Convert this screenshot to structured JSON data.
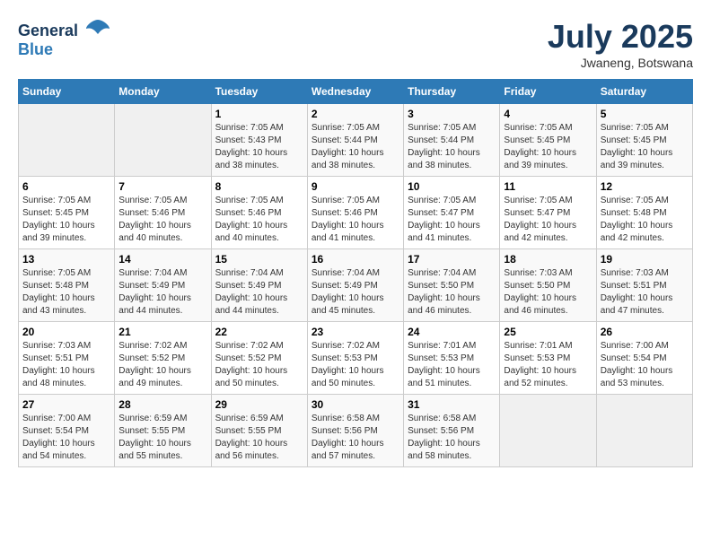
{
  "header": {
    "logo_general": "General",
    "logo_blue": "Blue",
    "month_title": "July 2025",
    "location": "Jwaneng, Botswana"
  },
  "calendar": {
    "days_of_week": [
      "Sunday",
      "Monday",
      "Tuesday",
      "Wednesday",
      "Thursday",
      "Friday",
      "Saturday"
    ],
    "weeks": [
      [
        {
          "day": "",
          "details": ""
        },
        {
          "day": "",
          "details": ""
        },
        {
          "day": "1",
          "details": "Sunrise: 7:05 AM\nSunset: 5:43 PM\nDaylight: 10 hours and 38 minutes."
        },
        {
          "day": "2",
          "details": "Sunrise: 7:05 AM\nSunset: 5:44 PM\nDaylight: 10 hours and 38 minutes."
        },
        {
          "day": "3",
          "details": "Sunrise: 7:05 AM\nSunset: 5:44 PM\nDaylight: 10 hours and 38 minutes."
        },
        {
          "day": "4",
          "details": "Sunrise: 7:05 AM\nSunset: 5:45 PM\nDaylight: 10 hours and 39 minutes."
        },
        {
          "day": "5",
          "details": "Sunrise: 7:05 AM\nSunset: 5:45 PM\nDaylight: 10 hours and 39 minutes."
        }
      ],
      [
        {
          "day": "6",
          "details": "Sunrise: 7:05 AM\nSunset: 5:45 PM\nDaylight: 10 hours and 39 minutes."
        },
        {
          "day": "7",
          "details": "Sunrise: 7:05 AM\nSunset: 5:46 PM\nDaylight: 10 hours and 40 minutes."
        },
        {
          "day": "8",
          "details": "Sunrise: 7:05 AM\nSunset: 5:46 PM\nDaylight: 10 hours and 40 minutes."
        },
        {
          "day": "9",
          "details": "Sunrise: 7:05 AM\nSunset: 5:46 PM\nDaylight: 10 hours and 41 minutes."
        },
        {
          "day": "10",
          "details": "Sunrise: 7:05 AM\nSunset: 5:47 PM\nDaylight: 10 hours and 41 minutes."
        },
        {
          "day": "11",
          "details": "Sunrise: 7:05 AM\nSunset: 5:47 PM\nDaylight: 10 hours and 42 minutes."
        },
        {
          "day": "12",
          "details": "Sunrise: 7:05 AM\nSunset: 5:48 PM\nDaylight: 10 hours and 42 minutes."
        }
      ],
      [
        {
          "day": "13",
          "details": "Sunrise: 7:05 AM\nSunset: 5:48 PM\nDaylight: 10 hours and 43 minutes."
        },
        {
          "day": "14",
          "details": "Sunrise: 7:04 AM\nSunset: 5:49 PM\nDaylight: 10 hours and 44 minutes."
        },
        {
          "day": "15",
          "details": "Sunrise: 7:04 AM\nSunset: 5:49 PM\nDaylight: 10 hours and 44 minutes."
        },
        {
          "day": "16",
          "details": "Sunrise: 7:04 AM\nSunset: 5:49 PM\nDaylight: 10 hours and 45 minutes."
        },
        {
          "day": "17",
          "details": "Sunrise: 7:04 AM\nSunset: 5:50 PM\nDaylight: 10 hours and 46 minutes."
        },
        {
          "day": "18",
          "details": "Sunrise: 7:03 AM\nSunset: 5:50 PM\nDaylight: 10 hours and 46 minutes."
        },
        {
          "day": "19",
          "details": "Sunrise: 7:03 AM\nSunset: 5:51 PM\nDaylight: 10 hours and 47 minutes."
        }
      ],
      [
        {
          "day": "20",
          "details": "Sunrise: 7:03 AM\nSunset: 5:51 PM\nDaylight: 10 hours and 48 minutes."
        },
        {
          "day": "21",
          "details": "Sunrise: 7:02 AM\nSunset: 5:52 PM\nDaylight: 10 hours and 49 minutes."
        },
        {
          "day": "22",
          "details": "Sunrise: 7:02 AM\nSunset: 5:52 PM\nDaylight: 10 hours and 50 minutes."
        },
        {
          "day": "23",
          "details": "Sunrise: 7:02 AM\nSunset: 5:53 PM\nDaylight: 10 hours and 50 minutes."
        },
        {
          "day": "24",
          "details": "Sunrise: 7:01 AM\nSunset: 5:53 PM\nDaylight: 10 hours and 51 minutes."
        },
        {
          "day": "25",
          "details": "Sunrise: 7:01 AM\nSunset: 5:53 PM\nDaylight: 10 hours and 52 minutes."
        },
        {
          "day": "26",
          "details": "Sunrise: 7:00 AM\nSunset: 5:54 PM\nDaylight: 10 hours and 53 minutes."
        }
      ],
      [
        {
          "day": "27",
          "details": "Sunrise: 7:00 AM\nSunset: 5:54 PM\nDaylight: 10 hours and 54 minutes."
        },
        {
          "day": "28",
          "details": "Sunrise: 6:59 AM\nSunset: 5:55 PM\nDaylight: 10 hours and 55 minutes."
        },
        {
          "day": "29",
          "details": "Sunrise: 6:59 AM\nSunset: 5:55 PM\nDaylight: 10 hours and 56 minutes."
        },
        {
          "day": "30",
          "details": "Sunrise: 6:58 AM\nSunset: 5:56 PM\nDaylight: 10 hours and 57 minutes."
        },
        {
          "day": "31",
          "details": "Sunrise: 6:58 AM\nSunset: 5:56 PM\nDaylight: 10 hours and 58 minutes."
        },
        {
          "day": "",
          "details": ""
        },
        {
          "day": "",
          "details": ""
        }
      ]
    ]
  }
}
